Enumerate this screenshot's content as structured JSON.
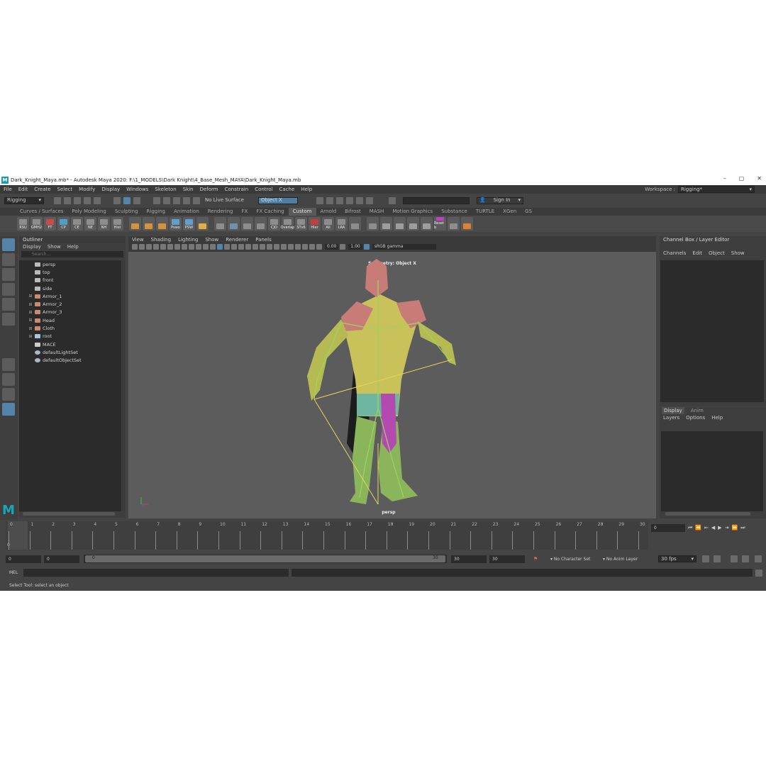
{
  "window": {
    "title": "Dark_Knight_Maya.mb* - Autodesk Maya 2020: F:\\1_MODELS\\Dark Knight\\4_Base_Mesh_MAYA\\Dark_Knight_Maya.mb",
    "logo_letter": "M",
    "minimize": "–",
    "maximize": "▢",
    "close": "✕"
  },
  "menubar": {
    "items": [
      "File",
      "Edit",
      "Create",
      "Select",
      "Modify",
      "Display",
      "Windows",
      "Skeleton",
      "Skin",
      "Deform",
      "Constrain",
      "Control",
      "Cache",
      "Help"
    ],
    "workspace_label": "Workspace :",
    "workspace_value": "Rigging*"
  },
  "statusline": {
    "menuset": "Rigging",
    "live_surface": "No Live Surface",
    "symmetry": "Object X",
    "sign_in": "Sign In"
  },
  "shelf_tabs": {
    "items": [
      "Curves / Surfaces",
      "Poly Modeling",
      "Sculpting",
      "Rigging",
      "Animation",
      "Rendering",
      "FX",
      "FX Caching",
      "Custom",
      "Arnold",
      "Bifrost",
      "MASH",
      "Motion Graphics",
      "Substance",
      "TURTLE",
      "XGen",
      "GS"
    ],
    "active": "Custom"
  },
  "shelf": {
    "buttons": [
      "RSU",
      "GMH2",
      "FT",
      "CP",
      "CE",
      "NE",
      "NH",
      "Hist",
      "",
      "",
      "",
      "Pswo",
      "PSW",
      "",
      "",
      "",
      "",
      "",
      "CJO",
      "Overlap",
      "STv6",
      "Hier",
      "All",
      "LRA",
      "",
      "",
      "",
      "",
      "",
      "",
      "Reset b",
      "",
      ""
    ]
  },
  "outliner": {
    "title": "Outliner",
    "menu": [
      "Display",
      "Show",
      "Help"
    ],
    "search_placeholder": "Search...",
    "items": [
      {
        "label": "persp",
        "kind": "camera",
        "expandable": false
      },
      {
        "label": "top",
        "kind": "camera",
        "expandable": false
      },
      {
        "label": "front",
        "kind": "camera",
        "expandable": false
      },
      {
        "label": "side",
        "kind": "camera",
        "expandable": false
      },
      {
        "label": "Armor_1",
        "kind": "mesh",
        "expandable": true
      },
      {
        "label": "Armor_2",
        "kind": "mesh",
        "expandable": true
      },
      {
        "label": "Armor_3",
        "kind": "mesh",
        "expandable": true
      },
      {
        "label": "Head",
        "kind": "mesh",
        "expandable": true
      },
      {
        "label": "Cloth",
        "kind": "mesh",
        "expandable": true
      },
      {
        "label": "root",
        "kind": "joint",
        "expandable": true
      },
      {
        "label": "MACE",
        "kind": "group",
        "expandable": false
      },
      {
        "label": "defaultLightSet",
        "kind": "set",
        "expandable": false
      },
      {
        "label": "defaultObjectSet",
        "kind": "set",
        "expandable": false
      }
    ]
  },
  "viewport": {
    "menu": [
      "View",
      "Shading",
      "Lighting",
      "Show",
      "Renderer",
      "Panels"
    ],
    "exposure": "0.00",
    "gamma": "1.00",
    "color_space": "sRGB gamma",
    "symmetry_label": "Symmetry: Object X",
    "camera_label": "persp"
  },
  "channelbox": {
    "title": "Channel Box / Layer Editor",
    "menu": [
      "Channels",
      "Edit",
      "Object",
      "Show"
    ]
  },
  "layer_editor": {
    "tabs": [
      "Display",
      "Anim"
    ],
    "active_tab": "Display",
    "menu": [
      "Layers",
      "Options",
      "Help"
    ]
  },
  "timeline": {
    "ticks": [
      "0",
      "1",
      "2",
      "3",
      "4",
      "5",
      "6",
      "7",
      "8",
      "9",
      "10",
      "11",
      "12",
      "13",
      "14",
      "15",
      "16",
      "17",
      "18",
      "19",
      "20",
      "21",
      "22",
      "23",
      "24",
      "25",
      "26",
      "27",
      "28",
      "29",
      "30"
    ],
    "current_frame": "0",
    "current_time_field": "0"
  },
  "range": {
    "start": "0",
    "playback_start": "0",
    "slider_start": "0",
    "slider_end": "30",
    "playback_end": "30",
    "end": "30",
    "character_set": "No Character Set",
    "anim_layer": "No Anim Layer",
    "fps": "30 fps"
  },
  "commandline": {
    "label": "MEL"
  },
  "helpline": {
    "text": "Select Tool: select an object"
  }
}
